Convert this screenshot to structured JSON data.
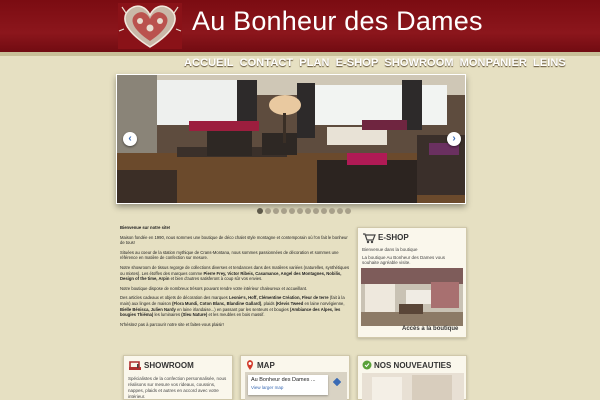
{
  "header": {
    "title": "Au Bonheur des Dames"
  },
  "nav": [
    "ACCUEIL",
    "CONTACT",
    "PLAN",
    "E-SHOP",
    "SHOWROOM",
    "MONPANIER",
    "LEINS"
  ],
  "slider": {
    "prev_label": "‹",
    "next_label": "›",
    "dot_count": 12,
    "active_dot": 0
  },
  "intro": {
    "greeting": "Bienvenue sur notre site!",
    "p1": "Maison fondée en 1990, nous sommes une boutique de déco chalet style montagne et contemporain où l'on fait le bonheur de tous!",
    "p2": "Situées au coeur de la station mythique de Crans-Montana, nous sommes passionnées de décoration et sommes une référence en matière de confection sur mesure.",
    "p3_start": "Notre showroom de tissus regorge de collections diverses et tendances dans des matières variées (naturelles, synthétiques ou mixtes). Les étoffes des marques comme ",
    "p3_brands": "Pierre Frey, Victor Ribeis, Casamance, Angel des Montagnes, Nobilis, Design of the time, Arpin",
    "p3_end": " et bien d'autres satisferont à coup sûr vos envies.",
    "p4": "Notre boutique dispose de nombreux trésors pouvant rendre votre intérieur chaleureux et accueillant.",
    "p5_start": "Des articles cadeaux et objets de décoration des marques ",
    "p5_brands": "Leonie's, Hoff, Clémentine Création, Fleur de terre",
    "p5_mid": " (fait à la main) aux linges de maison ",
    "p5_brands2": "(Flora Mundi, Coton Blanc, Blandine Gallard)",
    "p5_mid2": ", plaids ",
    "p5_brands3": "(Klevis Tweed",
    "p5_mid3": " en laine norvégienne, ",
    "p5_brands4": "Bielle Bénisca, Julien Nardy",
    "p5_mid4": " en laine irlandaise...) en passant par les senteurs et bougies ",
    "p5_brands5": "(Ambiance des Alpes, les bougies Thiéma)",
    "p5_mid5": " les luminaires ",
    "p5_brands6": "(Sleu Nature)",
    "p5_end": " et les meubles en bois massif.",
    "p6": "N'hésitez pas à parcourir notre site et faites-vous plaisir!"
  },
  "eshop": {
    "title": "E-SHOP",
    "line1": "Bienvenue dans la boutique",
    "line2": "La boutique Au Bonheur des Dames vous",
    "line3": "souhaite agréable visite.",
    "link": "Accès a la boutique"
  },
  "showroom": {
    "title": "SHOWROOM",
    "text": "Spécialistes de la confection personnalisée, nous réalisons sur mesure vos rideaux, coussins, nappes, plaids et autres en accord avec votre intérieur."
  },
  "map": {
    "title": "MAP",
    "place": "Au Bonheur des Dames ...",
    "larger": "View larger map"
  },
  "news": {
    "title": "NOS NOUVEAUTIES"
  },
  "colors": {
    "header": "#7b0c12",
    "background": "#e6e0c2",
    "accent_green": "#5aa13a"
  }
}
